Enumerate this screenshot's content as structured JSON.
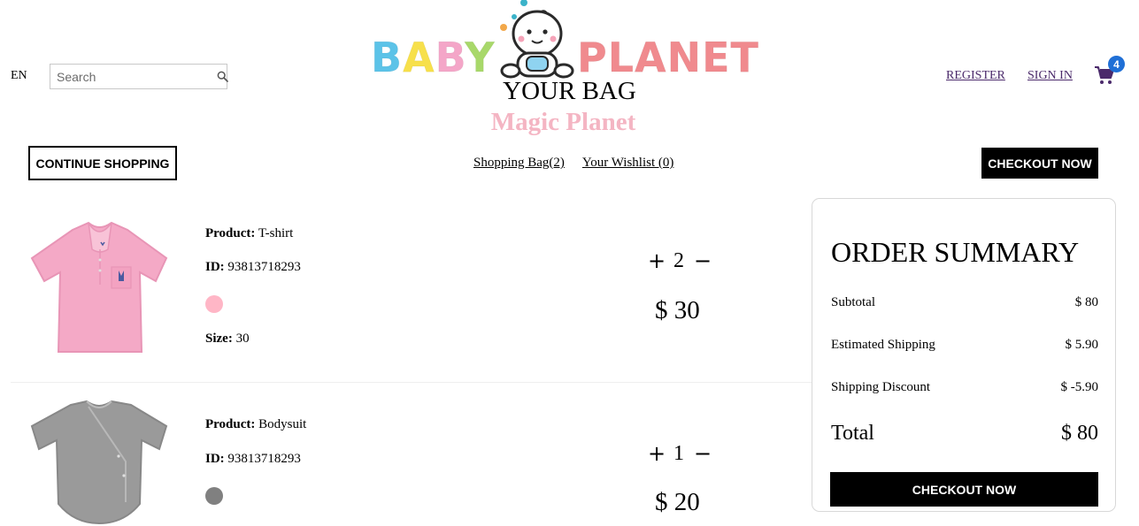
{
  "header": {
    "language": "EN",
    "search_placeholder": "Search",
    "logo": {
      "word1": "BABY",
      "word2": "PLANET"
    },
    "register": "REGISTER",
    "sign_in": "SIGN IN",
    "cart_count": "4"
  },
  "page": {
    "title": "YOUR BAG",
    "subtitle": "Magic Planet"
  },
  "toolbar": {
    "continue_label": "CONTINUE SHOPPING",
    "tab_bag": "Shopping Bag(2)",
    "tab_wishlist": "Your Wishlist (0)",
    "checkout_label": "CHECKOUT NOW"
  },
  "products": [
    {
      "product_label": "Product:",
      "product_name": "T-shirt",
      "id_label": "ID:",
      "id": "93813718293",
      "color": "#ffb6c6",
      "size_label": "Size:",
      "size": "30",
      "quantity": "2",
      "price": "$ 30"
    },
    {
      "product_label": "Product:",
      "product_name": "Bodysuit",
      "id_label": "ID:",
      "id": "93813718293",
      "color": "#808080",
      "quantity": "1",
      "price": "$ 20"
    }
  ],
  "summary": {
    "title": "ORDER SUMMARY",
    "subtotal_label": "Subtotal",
    "subtotal": "$ 80",
    "shipping_label": "Estimated Shipping",
    "shipping": "$ 5.90",
    "discount_label": "Shipping Discount",
    "discount": "$ -5.90",
    "total_label": "Total",
    "total": "$ 80",
    "checkout_label": "CHECKOUT NOW"
  },
  "icons": {
    "search": "search-icon",
    "cart": "shopping-cart-icon",
    "plus": "plus-icon",
    "minus": "minus-icon"
  },
  "colors": {
    "link": "#4b2a6b",
    "badge": "#1f6fd6",
    "subtitle": "#f4b5c3",
    "logo_planet": "#f08a8e"
  }
}
